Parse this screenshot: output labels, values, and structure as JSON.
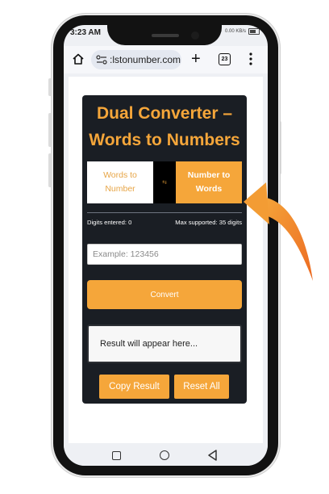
{
  "status": {
    "time": "3:23 AM",
    "network": "0.00 KB/s"
  },
  "browser": {
    "url": ":lstonumber.com",
    "tab_count": "23",
    "icons": [
      "home-icon",
      "site-settings-icon",
      "new-tab-icon",
      "tabs-icon",
      "menu-icon"
    ]
  },
  "converter": {
    "title": "Dual Converter – Words to Numbers",
    "mode_words_label": "Words to Number",
    "mode_swap_label": "⇆",
    "mode_number_label": "Number to Words",
    "digits_entered": "Digits entered: 0",
    "max_supported": "Max supported: 35 digits",
    "input_placeholder": "Example: 123456",
    "input_value": "",
    "convert_label": "Convert",
    "result_text": "Result will appear here...",
    "copy_label": "Copy Result",
    "reset_label": "Reset All"
  },
  "colors": {
    "accent": "#f5a63a",
    "card_bg": "#1a1e24",
    "arrow": "#f08a2a"
  }
}
